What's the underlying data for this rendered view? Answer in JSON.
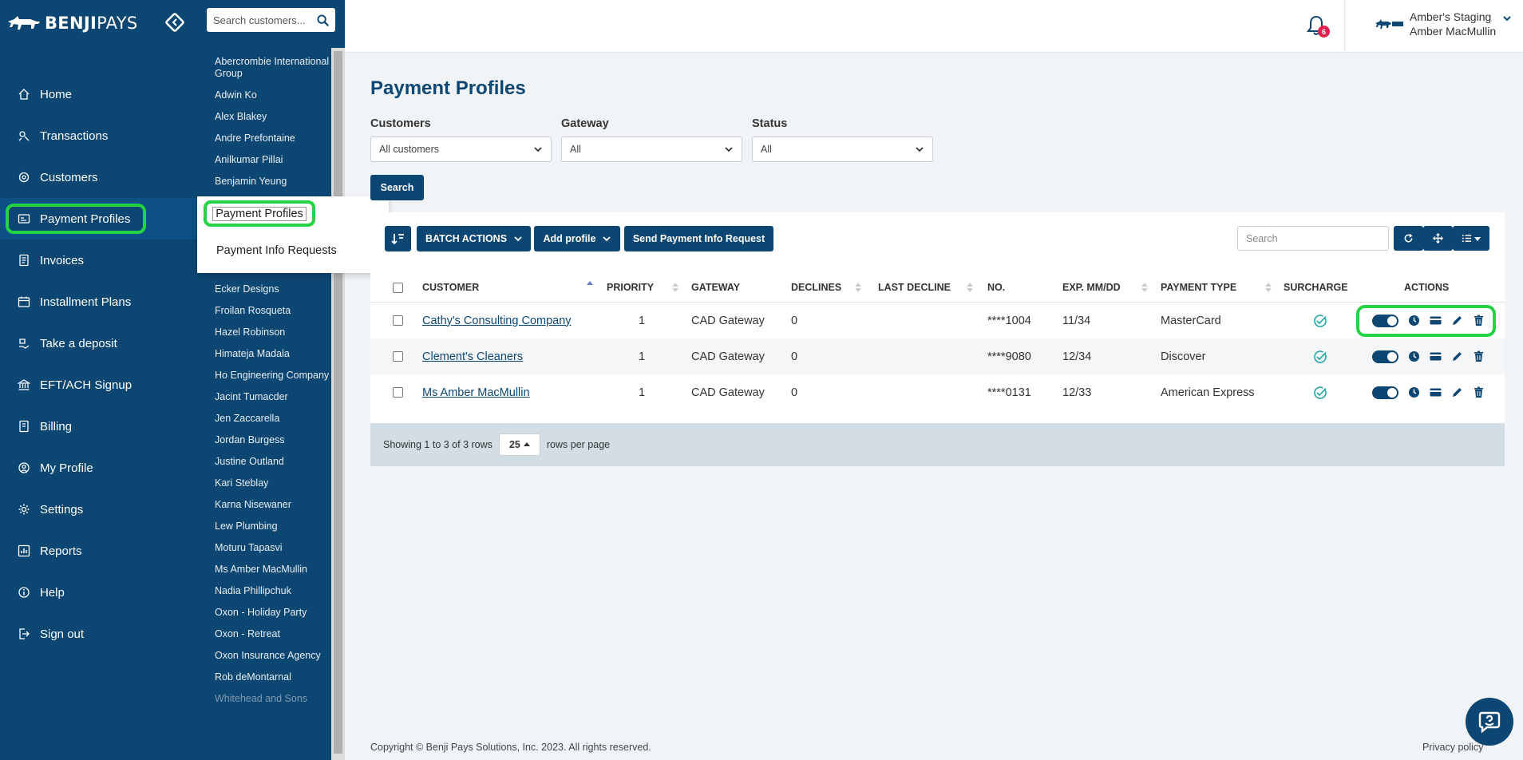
{
  "brand": {
    "name_bold": "BENJI",
    "name_light": "PAYS"
  },
  "nav": {
    "items": [
      {
        "label": "Home",
        "icon": "home-icon"
      },
      {
        "label": "Transactions",
        "icon": "transactions-icon"
      },
      {
        "label": "Customers",
        "icon": "customers-icon"
      },
      {
        "label": "Payment Profiles",
        "icon": "payment-profiles-icon",
        "active": true
      },
      {
        "label": "Invoices",
        "icon": "invoices-icon"
      },
      {
        "label": "Installment Plans",
        "icon": "calendar-icon"
      },
      {
        "label": "Take a deposit",
        "icon": "deposit-icon"
      },
      {
        "label": "EFT/ACH Signup",
        "icon": "bank-icon"
      },
      {
        "label": "Billing",
        "icon": "billing-icon"
      },
      {
        "label": "My Profile",
        "icon": "profile-icon"
      },
      {
        "label": "Settings",
        "icon": "gear-icon"
      },
      {
        "label": "Reports",
        "icon": "reports-icon"
      },
      {
        "label": "Help",
        "icon": "info-icon"
      },
      {
        "label": "Sign out",
        "icon": "sign-out-icon"
      }
    ]
  },
  "customer_panel": {
    "search_placeholder": "Search customers...",
    "customers": [
      "Abercrombie International Group",
      "Adwin Ko",
      "Alex Blakey",
      "Andre Prefontaine",
      "Anilkumar Pillai",
      "Benjamin Yeung",
      "",
      "",
      "",
      "Clement's Cleaners",
      "Ecker Designs",
      "Froilan Rosqueta",
      "Hazel Robinson",
      "Himateja Madala",
      "Ho Engineering Company",
      "Jacint Tumacder",
      "Jen Zaccarella",
      "Jordan Burgess",
      "Justine Outland",
      "Kari Steblay",
      "Karna Nisewaner",
      "Lew Plumbing",
      "Moturu Tapasvi",
      "Ms Amber MacMullin",
      "Nadia Phillipchuk",
      "Oxon - Holiday Party",
      "Oxon - Retreat",
      "Oxon Insurance Agency",
      "Rob deMontarnal",
      "Whitehead and Sons"
    ]
  },
  "flyout": {
    "item1": "Payment Profiles",
    "item2": "Payment Info Requests"
  },
  "header": {
    "notifications_count": "6",
    "account_org": "Amber's Staging",
    "account_user": "Amber MacMullin"
  },
  "page": {
    "title": "Payment Profiles"
  },
  "filters": {
    "customers_label": "Customers",
    "customers_value": "All customers",
    "gateway_label": "Gateway",
    "gateway_value": "All",
    "status_label": "Status",
    "status_value": "All",
    "search_button": "Search"
  },
  "toolbar": {
    "batch_actions": "BATCH ACTIONS",
    "add_profile": "Add profile",
    "send_request": "Send Payment Info Request",
    "search_placeholder": "Search"
  },
  "table": {
    "columns": [
      "CUSTOMER",
      "PRIORITY",
      "GATEWAY",
      "DECLINES",
      "LAST DECLINE",
      "NO.",
      "EXP. MM/DD",
      "PAYMENT TYPE",
      "SURCHARGE",
      "ACTIONS"
    ],
    "rows": [
      {
        "customer": "Cathy's Consulting Company",
        "priority": "1",
        "gateway": "CAD Gateway",
        "declines": "0",
        "last_decline": "",
        "no": "****1004",
        "exp": "11/34",
        "payment_type": "MasterCard"
      },
      {
        "customer": "Clement's Cleaners",
        "priority": "1",
        "gateway": "CAD Gateway",
        "declines": "0",
        "last_decline": "",
        "no": "****9080",
        "exp": "12/34",
        "payment_type": "Discover"
      },
      {
        "customer": "Ms Amber MacMullin",
        "priority": "1",
        "gateway": "CAD Gateway",
        "declines": "0",
        "last_decline": "",
        "no": "****0131",
        "exp": "12/33",
        "payment_type": "American Express"
      }
    ],
    "footer": {
      "showing": "Showing 1 to 3 of 3 rows",
      "per_page": "25",
      "per_page_suffix": "rows per page"
    }
  },
  "footer": {
    "copyright": "Copyright © Benji Pays Solutions, Inc. 2023. All rights reserved.",
    "privacy": "Privacy policy"
  },
  "colors": {
    "primary": "#0c4672",
    "highlight": "#22d443",
    "badge": "#e0234e",
    "surcharge_check": "#1aa3a3"
  }
}
